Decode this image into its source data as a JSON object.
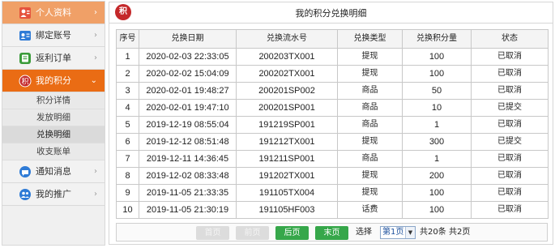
{
  "sidebar": {
    "menu": [
      {
        "label": "个人资料",
        "icon": "user-icon",
        "color": "#e5533d"
      },
      {
        "label": "绑定账号",
        "icon": "id-card-icon",
        "color": "#2e7bd6"
      },
      {
        "label": "返利订单",
        "icon": "order-icon",
        "color": "#3a9b3a"
      },
      {
        "label": "我的积分",
        "icon": "points-icon",
        "color": "#c4282a"
      },
      {
        "label": "通知消息",
        "icon": "message-icon",
        "color": "#2e7bd6"
      },
      {
        "label": "我的推广",
        "icon": "promotion-icon",
        "color": "#2e7bd6"
      }
    ],
    "submenu": [
      "积分详情",
      "发放明细",
      "兑换明细",
      "收支账单"
    ]
  },
  "panel": {
    "logo_text": "积",
    "title": "我的积分兑换明细"
  },
  "table": {
    "headers": [
      "序号",
      "兑换日期",
      "兑换流水号",
      "兑换类型",
      "兑换积分量",
      "状态"
    ],
    "rows": [
      [
        "1",
        "2020-02-03 22:33:05",
        "200203TX001",
        "提现",
        "100",
        "已取消"
      ],
      [
        "2",
        "2020-02-02 15:04:09",
        "200202TX001",
        "提现",
        "100",
        "已取消"
      ],
      [
        "3",
        "2020-02-01 19:48:27",
        "200201SP002",
        "商品",
        "50",
        "已取消"
      ],
      [
        "4",
        "2020-02-01 19:47:10",
        "200201SP001",
        "商品",
        "10",
        "已提交"
      ],
      [
        "5",
        "2019-12-19 08:55:04",
        "191219SP001",
        "商品",
        "1",
        "已取消"
      ],
      [
        "6",
        "2019-12-12 08:51:48",
        "191212TX001",
        "提现",
        "300",
        "已提交"
      ],
      [
        "7",
        "2019-12-11 14:36:45",
        "191211SP001",
        "商品",
        "1",
        "已取消"
      ],
      [
        "8",
        "2019-12-02 08:33:48",
        "191202TX001",
        "提现",
        "200",
        "已取消"
      ],
      [
        "9",
        "2019-11-05 21:33:35",
        "191105TX004",
        "提现",
        "100",
        "已取消"
      ],
      [
        "10",
        "2019-11-05 21:30:19",
        "191105HF003",
        "话费",
        "100",
        "已取消"
      ]
    ]
  },
  "pager": {
    "first": "首页",
    "prev": "前页",
    "next": "后页",
    "last": "末页",
    "select_label": "选择",
    "current_page": "第1页",
    "total_items": "共20条",
    "total_pages": "共2页"
  },
  "colors": {
    "accent": "#ea6c14",
    "green_button": "#36a74a",
    "logo_red": "#c4282a"
  }
}
